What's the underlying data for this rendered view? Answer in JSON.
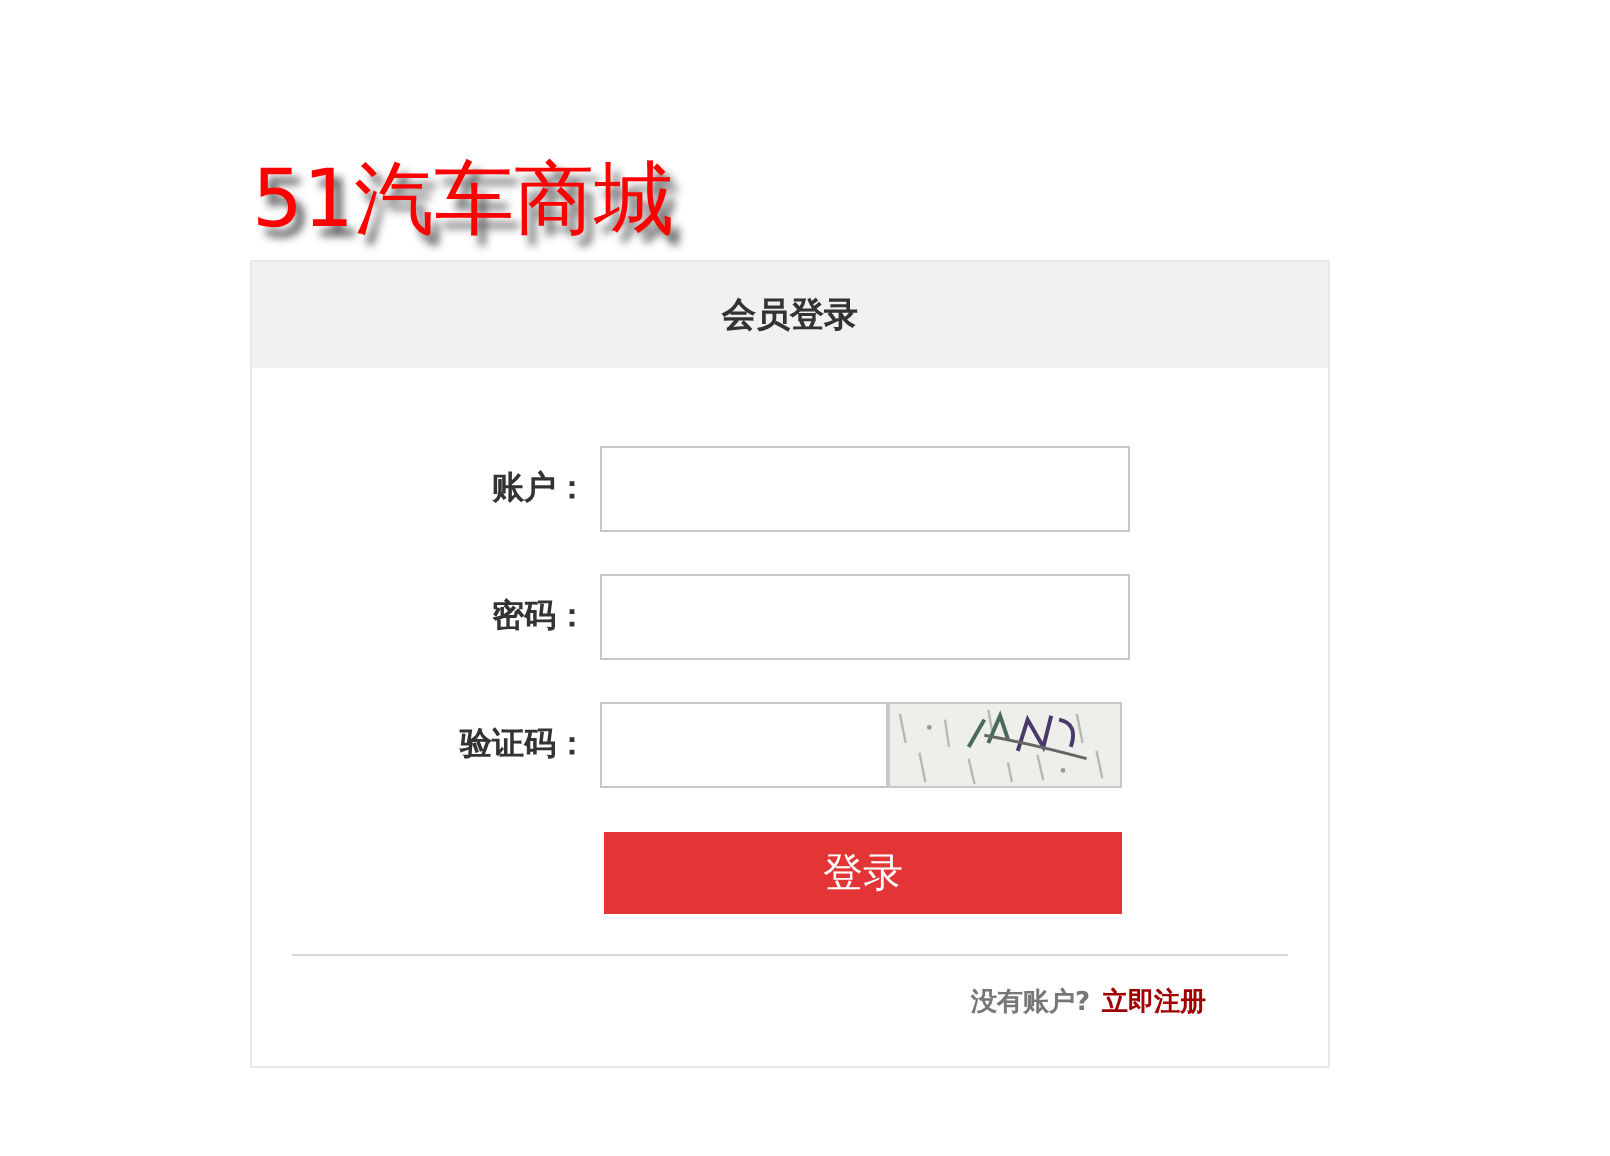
{
  "logo": "51汽车商城",
  "panel": {
    "title": "会员登录"
  },
  "fields": [
    {
      "kind": "text",
      "label": "账户："
    },
    {
      "kind": "password",
      "label": "密码："
    },
    {
      "kind": "captcha",
      "label": "验证码："
    }
  ],
  "submit": "登录",
  "footer": {
    "prompt": "没有账户?",
    "link": "立即注册"
  }
}
